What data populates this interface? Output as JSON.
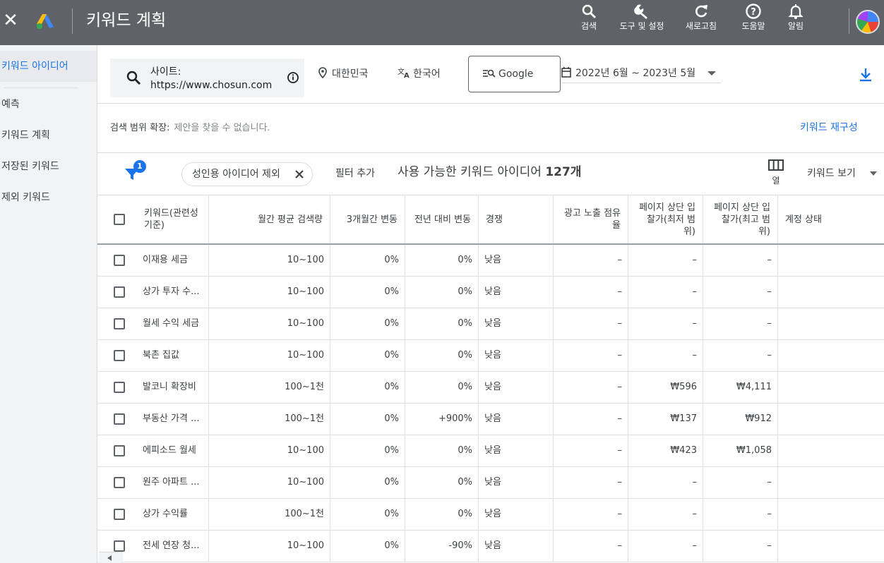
{
  "app": {
    "title": "키워드 계획",
    "close_symbol": "✕"
  },
  "topbar_actions": [
    {
      "label": "검색",
      "icon": "search-icon"
    },
    {
      "label": "도구 및 설정",
      "icon": "wrench-icon"
    },
    {
      "label": "새로고침",
      "icon": "refresh-icon"
    },
    {
      "label": "도움말",
      "icon": "help-icon"
    },
    {
      "label": "알림",
      "icon": "bell-icon"
    }
  ],
  "sidebar": {
    "items": [
      {
        "label": "키워드 아이디어",
        "active": true
      },
      {
        "label": "예측",
        "active": false
      },
      {
        "label": "키워드 계획",
        "active": false
      },
      {
        "label": "저장된 키워드",
        "active": false
      },
      {
        "label": "제외 키워드",
        "active": false
      }
    ]
  },
  "header": {
    "site_label": "사이트:",
    "site_url": "https://www.chosun.com",
    "location": "대한민국",
    "language": "한국어",
    "network": "Google",
    "date_range": "2022년 6월 ~ 2023년 5월"
  },
  "expand": {
    "label": "검색 범위 확장:",
    "message": "제안을 찾을 수 없습니다.",
    "refine_link": "키워드 재구성"
  },
  "filters": {
    "badge_count": "1",
    "chip_label": "성인용 아이디어 제외",
    "add_filter": "필터 추가",
    "ideas_prefix": "사용 가능한 키워드 아이디어",
    "ideas_count": "127개",
    "columns_label": "열",
    "view_label": "키워드 보기"
  },
  "table": {
    "columns": [
      "키워드(관련성 기준)",
      "월간 평균 검색량",
      "3개월간 변동",
      "전년 대비 변동",
      "경쟁",
      "광고 노출 점유율",
      "페이지 상단 입찰가(최저 범위)",
      "페이지 상단 입찰가(최고 범위)",
      "계정 상태"
    ],
    "rows": [
      {
        "keyword": "이재용 세금",
        "volume": "10~100",
        "three_month": "0%",
        "yoy": "0%",
        "competition": "낮음",
        "impression_share": "–",
        "bid_low": "–",
        "bid_high": "–",
        "status": ""
      },
      {
        "keyword": "상가 투자 수...",
        "volume": "10~100",
        "three_month": "0%",
        "yoy": "0%",
        "competition": "낮음",
        "impression_share": "–",
        "bid_low": "–",
        "bid_high": "–",
        "status": ""
      },
      {
        "keyword": "월세 수익 세금",
        "volume": "10~100",
        "three_month": "0%",
        "yoy": "0%",
        "competition": "낮음",
        "impression_share": "–",
        "bid_low": "–",
        "bid_high": "–",
        "status": ""
      },
      {
        "keyword": "북촌 집값",
        "volume": "10~100",
        "three_month": "0%",
        "yoy": "0%",
        "competition": "낮음",
        "impression_share": "–",
        "bid_low": "–",
        "bid_high": "–",
        "status": ""
      },
      {
        "keyword": "발코니 확장비",
        "volume": "100~1천",
        "three_month": "0%",
        "yoy": "0%",
        "competition": "낮음",
        "impression_share": "–",
        "bid_low": "₩596",
        "bid_high": "₩4,111",
        "status": ""
      },
      {
        "keyword": "부동산 가격 ...",
        "volume": "100~1천",
        "three_month": "0%",
        "yoy": "+900%",
        "competition": "낮음",
        "impression_share": "–",
        "bid_low": "₩137",
        "bid_high": "₩912",
        "status": ""
      },
      {
        "keyword": "에피소드 월세",
        "volume": "10~100",
        "three_month": "0%",
        "yoy": "0%",
        "competition": "낮음",
        "impression_share": "–",
        "bid_low": "₩423",
        "bid_high": "₩1,058",
        "status": ""
      },
      {
        "keyword": "원주 아파트 ...",
        "volume": "10~100",
        "three_month": "0%",
        "yoy": "0%",
        "competition": "낮음",
        "impression_share": "–",
        "bid_low": "–",
        "bid_high": "–",
        "status": ""
      },
      {
        "keyword": "상가 수익률",
        "volume": "100~1천",
        "three_month": "0%",
        "yoy": "0%",
        "competition": "낮음",
        "impression_share": "–",
        "bid_low": "–",
        "bid_high": "–",
        "status": ""
      },
      {
        "keyword": "전세 연장 청...",
        "volume": "10~100",
        "three_month": "0%",
        "yoy": "-90%",
        "competition": "낮음",
        "impression_share": "–",
        "bid_low": "–",
        "bid_high": "–",
        "status": ""
      }
    ]
  },
  "colors": {
    "topbar": "#5f6368",
    "accent": "#1a73e8",
    "sidebar_bg": "#f1f3f4"
  }
}
